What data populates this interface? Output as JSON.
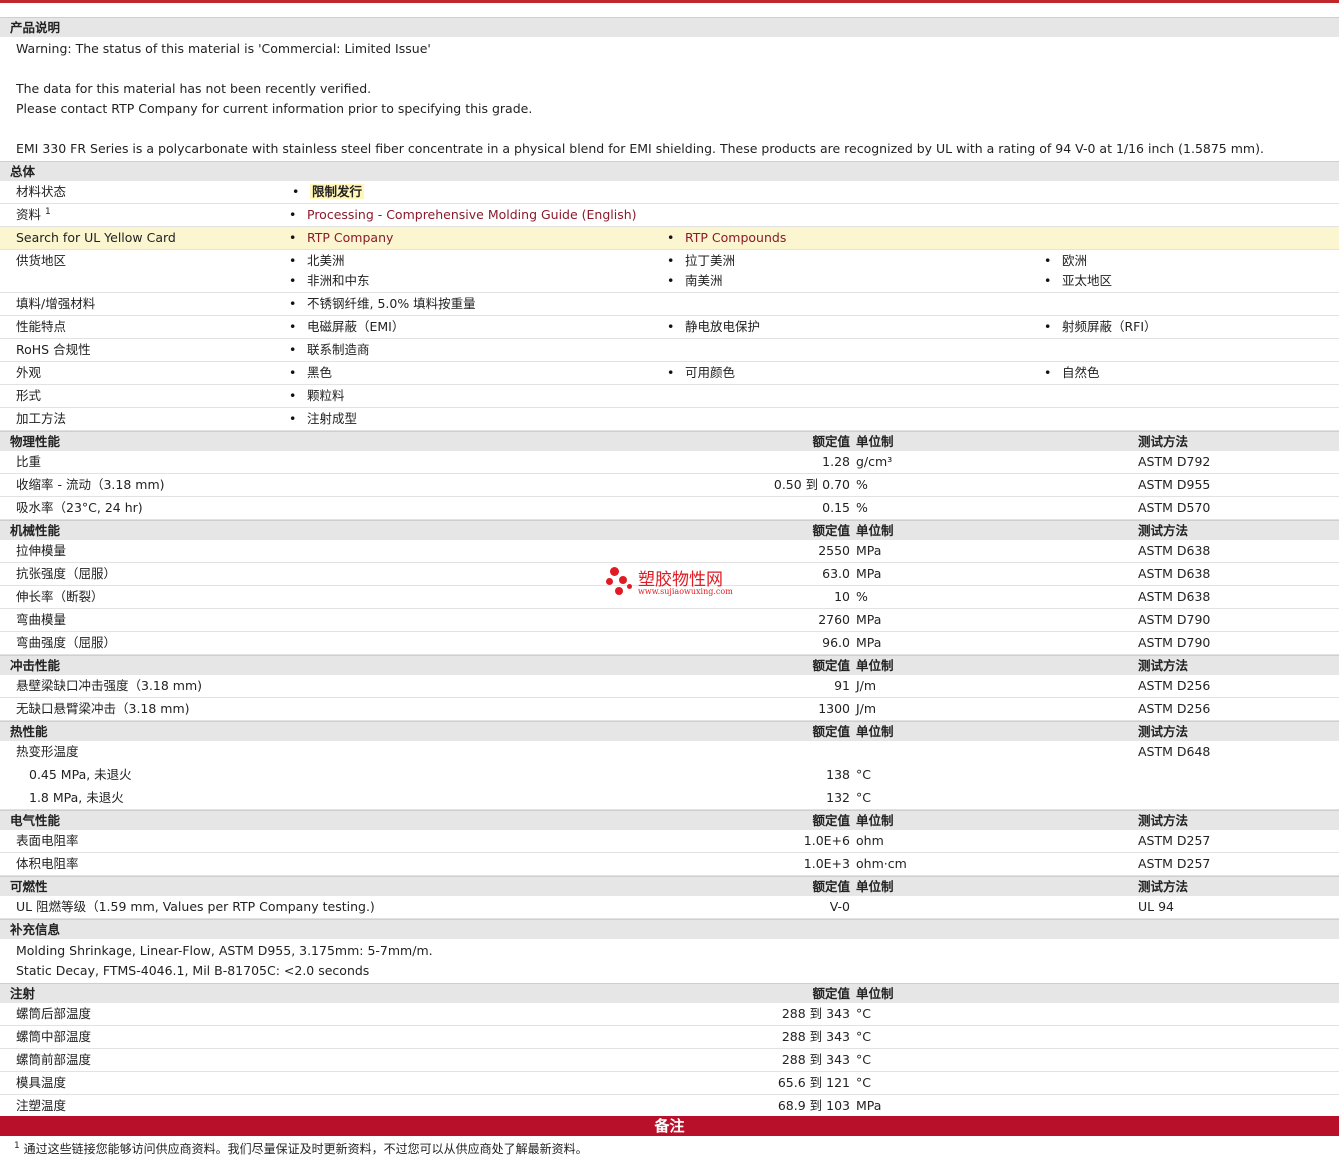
{
  "description": {
    "title": "产品说明",
    "lines": [
      "Warning: The status of this material is 'Commercial: Limited Issue'",
      "",
      "The data for this material has not been recently verified.",
      "Please contact RTP Company for current information prior to specifying this grade.",
      "",
      "EMI 330 FR Series is a polycarbonate with stainless steel fiber concentrate in a physical blend for EMI shielding. These products are recognized by UL with a rating of 94 V-0 at 1/16 inch (1.5875 mm)."
    ]
  },
  "general": {
    "title": "总体",
    "material_status": {
      "label": "材料状态",
      "value": "限制发行"
    },
    "resources": {
      "label": "资料",
      "sup": "1",
      "link": "Processing - Comprehensive Molding Guide (English)"
    },
    "ul_card": {
      "label": "Search for UL Yellow Card",
      "links": [
        "RTP Company",
        "RTP Compounds"
      ]
    },
    "availability": {
      "label": "供货地区",
      "items": [
        "北美洲",
        "拉丁美洲",
        "欧洲",
        "非洲和中东",
        "南美洲",
        "亚太地区"
      ]
    },
    "filler": {
      "label": "填料/增强材料",
      "items": [
        "不锈钢纤维, 5.0% 填料按重量"
      ]
    },
    "features": {
      "label": "性能特点",
      "items": [
        "电磁屏蔽（EMI）",
        "静电放电保护",
        "射频屏蔽（RFI）"
      ]
    },
    "rohs": {
      "label": "RoHS 合规性",
      "items": [
        "联系制造商"
      ]
    },
    "appearance": {
      "label": "外观",
      "items": [
        "黑色",
        "可用颜色",
        "自然色"
      ]
    },
    "form": {
      "label": "形式",
      "items": [
        "颗粒料"
      ]
    },
    "processing": {
      "label": "加工方法",
      "items": [
        "注射成型"
      ]
    }
  },
  "headers": {
    "value": "额定值",
    "unit": "单位制",
    "test": "测试方法"
  },
  "physical": {
    "title": "物理性能",
    "rows": [
      {
        "label": "比重",
        "value": "1.28",
        "unit": "g/cm³",
        "test": "ASTM D792"
      },
      {
        "label": "收缩率  - 流动（3.18 mm)",
        "value": "0.50 到  0.70",
        "unit": "%",
        "test": "ASTM D955"
      },
      {
        "label": "吸水率（23°C, 24 hr)",
        "value": "0.15",
        "unit": "%",
        "test": "ASTM D570"
      }
    ]
  },
  "mechanical": {
    "title": "机械性能",
    "rows": [
      {
        "label": "拉伸模量",
        "value": "2550",
        "unit": "MPa",
        "test": "ASTM D638"
      },
      {
        "label": "抗张强度（屈服）",
        "value": "63.0",
        "unit": "MPa",
        "test": "ASTM D638"
      },
      {
        "label": "伸长率（断裂）",
        "value": "10",
        "unit": "%",
        "test": "ASTM D638"
      },
      {
        "label": "弯曲模量",
        "value": "2760",
        "unit": "MPa",
        "test": "ASTM D790"
      },
      {
        "label": "弯曲强度（屈服）",
        "value": "96.0",
        "unit": "MPa",
        "test": "ASTM D790"
      }
    ]
  },
  "impact": {
    "title": "冲击性能",
    "rows": [
      {
        "label": "悬壁梁缺口冲击强度（3.18 mm)",
        "value": "91",
        "unit": "J/m",
        "test": "ASTM D256"
      },
      {
        "label": "无缺口悬臂梁冲击（3.18 mm)",
        "value": "1300",
        "unit": "J/m",
        "test": "ASTM D256"
      }
    ]
  },
  "thermal": {
    "title": "热性能",
    "rows": [
      {
        "label": "热变形温度",
        "value": "",
        "unit": "",
        "test": "ASTM D648"
      },
      {
        "label": "0.45 MPa, 未退火",
        "value": "138",
        "unit": "°C",
        "test": ""
      },
      {
        "label": "1.8 MPa, 未退火",
        "value": "132",
        "unit": "°C",
        "test": ""
      }
    ]
  },
  "electrical": {
    "title": "电气性能",
    "rows": [
      {
        "label": "表面电阻率",
        "value": "1.0E+6",
        "unit": "ohm",
        "test": "ASTM D257"
      },
      {
        "label": "体积电阻率",
        "value": "1.0E+3",
        "unit": "ohm·cm",
        "test": "ASTM D257"
      }
    ]
  },
  "flammability": {
    "title": "可燃性",
    "rows": [
      {
        "label": "UL 阻燃等级（1.59 mm, Values per RTP Company testing.)",
        "value": "V-0",
        "unit": "",
        "test": "UL 94"
      }
    ]
  },
  "supplemental": {
    "title": "补充信息",
    "lines": [
      "Molding Shrinkage, Linear-Flow, ASTM D955, 3.175mm: 5-7mm/m.",
      "Static Decay, FTMS-4046.1, Mil B-81705C: <2.0 seconds"
    ]
  },
  "injection": {
    "title": "注射",
    "rows": [
      {
        "label": "螺筒后部温度",
        "value": "288 到  343",
        "unit": "°C"
      },
      {
        "label": "螺筒中部温度",
        "value": "288 到  343",
        "unit": "°C"
      },
      {
        "label": "螺筒前部温度",
        "value": "288 到  343",
        "unit": "°C"
      },
      {
        "label": "模具温度",
        "value": "65.6 到  121",
        "unit": "°C"
      },
      {
        "label": "注塑温度",
        "value": "68.9 到  103",
        "unit": "MPa"
      }
    ]
  },
  "notes": {
    "title": "备注",
    "footnote_mark": "1",
    "footnote": "通过这些链接您能够访问供应商资料。我们尽量保证及时更新资料，不过您可以从供应商处了解最新资料。"
  },
  "watermark": {
    "title": "塑胶物性网",
    "url": "www.sujiaowuxing.com"
  }
}
